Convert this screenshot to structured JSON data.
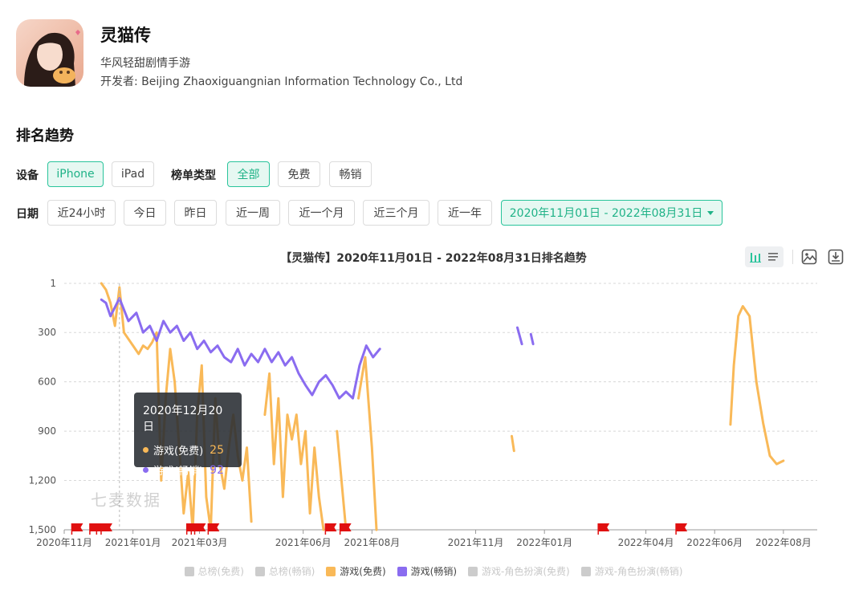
{
  "app": {
    "name": "灵猫传",
    "subtitle": "华风轻甜剧情手游",
    "developer": "开发者: Beijing Zhaoxiguangnian Information Technology Co., Ltd"
  },
  "section_title": "排名趋势",
  "filters": {
    "device_label": "设备",
    "devices": [
      {
        "label": "iPhone",
        "active": true
      },
      {
        "label": "iPad",
        "active": false
      }
    ],
    "list_type_label": "榜单类型",
    "list_types": [
      {
        "label": "全部",
        "active": true
      },
      {
        "label": "免费",
        "active": false
      },
      {
        "label": "畅销",
        "active": false
      }
    ],
    "date_label": "日期",
    "dates": [
      {
        "label": "近24小时"
      },
      {
        "label": "今日"
      },
      {
        "label": "昨日"
      },
      {
        "label": "近一周"
      },
      {
        "label": "近一个月"
      },
      {
        "label": "近三个月"
      },
      {
        "label": "近一年"
      }
    ],
    "date_range": "2020年11月01日 - 2022年08月31日"
  },
  "chart_title": "【灵猫传】2020年11月01日 - 2022年08月31日排名趋势",
  "toolbar_icons": [
    "bar-chart-icon",
    "list-icon",
    "image-icon",
    "download-icon"
  ],
  "tooltip": {
    "date": "2020年12月20日",
    "rows": [
      {
        "name": "游戏(免费)",
        "value": "25",
        "color": "#f9b958"
      },
      {
        "name": "游戏(畅销)",
        "value": "92",
        "color": "#8a6cf0"
      }
    ]
  },
  "watermark": "七麦数据",
  "colors": {
    "accent": "#1fb287",
    "free": "#f9b958",
    "grossing": "#8a6cf0",
    "flag": "#e01010",
    "legend_off": "#cccccc"
  },
  "legend": [
    {
      "label": "总榜(免费)",
      "on": false
    },
    {
      "label": "总榜(畅销)",
      "on": false
    },
    {
      "label": "游戏(免费)",
      "on": true
    },
    {
      "label": "游戏(畅销)",
      "on": true
    },
    {
      "label": "游戏-角色扮演(免费)",
      "on": false
    },
    {
      "label": "游戏-角色扮演(畅销)",
      "on": false
    }
  ],
  "chart_data": {
    "type": "line",
    "title": "【灵猫传】2020年11月01日 - 2022年08月31日排名趋势",
    "y_inverted": true,
    "ylim": [
      1,
      1500
    ],
    "y_ticks": [
      "1",
      "300",
      "600",
      "900",
      "1,200",
      "1,500"
    ],
    "x_ticks": [
      "2020年11月",
      "2021年01月",
      "2021年03月",
      "2021年06月",
      "2021年08月",
      "2021年11月",
      "2022年01月",
      "2022年04月",
      "2022年06月",
      "2022年08月"
    ],
    "grid": true,
    "legend_position": "bottom",
    "series": [
      {
        "name": "游戏(免费)",
        "color": "#f9b958",
        "segments": [
          [
            [
              "2020-12-04",
              1
            ],
            [
              "2020-12-08",
              40
            ],
            [
              "2020-12-12",
              120
            ],
            [
              "2020-12-16",
              260
            ],
            [
              "2020-12-20",
              25
            ],
            [
              "2020-12-24",
              300
            ],
            [
              "2021-01-01",
              380
            ],
            [
              "2021-01-06",
              430
            ],
            [
              "2021-01-10",
              380
            ],
            [
              "2021-01-14",
              400
            ],
            [
              "2021-01-18",
              360
            ],
            [
              "2021-01-22",
              300
            ],
            [
              "2021-01-26",
              1200
            ],
            [
              "2021-01-30",
              700
            ],
            [
              "2021-02-03",
              400
            ],
            [
              "2021-02-07",
              600
            ],
            [
              "2021-02-11",
              1000
            ],
            [
              "2021-02-15",
              1400
            ],
            [
              "2021-02-19",
              1150
            ],
            [
              "2021-02-23",
              1500
            ],
            [
              "2021-02-27",
              800
            ],
            [
              "2021-03-03",
              500
            ],
            [
              "2021-03-07",
              1300
            ],
            [
              "2021-03-11",
              1500
            ],
            [
              "2021-03-15",
              700
            ],
            [
              "2021-03-19",
              1100
            ],
            [
              "2021-03-23",
              1250
            ],
            [
              "2021-03-27",
              1000
            ],
            [
              "2021-03-31",
              800
            ],
            [
              "2021-04-04",
              1050
            ],
            [
              "2021-04-08",
              1200
            ],
            [
              "2021-04-12",
              1000
            ],
            [
              "2021-04-16",
              1450
            ]
          ],
          [
            [
              "2021-04-28",
              800
            ],
            [
              "2021-05-02",
              550
            ],
            [
              "2021-05-06",
              1100
            ],
            [
              "2021-05-10",
              700
            ],
            [
              "2021-05-14",
              1300
            ],
            [
              "2021-05-18",
              800
            ],
            [
              "2021-05-22",
              950
            ],
            [
              "2021-05-26",
              800
            ],
            [
              "2021-05-30",
              1100
            ],
            [
              "2021-06-03",
              900
            ],
            [
              "2021-06-07",
              1400
            ],
            [
              "2021-06-11",
              1000
            ],
            [
              "2021-06-15",
              1300
            ],
            [
              "2021-06-19",
              1500
            ]
          ],
          [
            [
              "2021-07-01",
              900
            ],
            [
              "2021-07-05",
              1200
            ],
            [
              "2021-07-09",
              1500
            ]
          ],
          [
            [
              "2021-07-20",
              700
            ],
            [
              "2021-07-26",
              450
            ],
            [
              "2021-08-01",
              1000
            ],
            [
              "2021-08-05",
              1500
            ]
          ],
          [
            [
              "2021-12-03",
              930
            ],
            [
              "2021-12-05",
              1020
            ]
          ],
          [
            [
              "2022-06-15",
              860
            ],
            [
              "2022-06-18",
              500
            ],
            [
              "2022-06-22",
              200
            ],
            [
              "2022-06-26",
              140
            ],
            [
              "2022-07-02",
              200
            ],
            [
              "2022-07-08",
              600
            ],
            [
              "2022-07-14",
              850
            ],
            [
              "2022-07-20",
              1050
            ],
            [
              "2022-07-26",
              1100
            ],
            [
              "2022-08-01",
              1080
            ]
          ]
        ]
      },
      {
        "name": "游戏(畅销)",
        "color": "#8a6cf0",
        "segments": [
          [
            [
              "2020-12-04",
              100
            ],
            [
              "2020-12-08",
              120
            ],
            [
              "2020-12-12",
              200
            ],
            [
              "2020-12-20",
              92
            ],
            [
              "2020-12-28",
              230
            ],
            [
              "2021-01-04",
              180
            ],
            [
              "2021-01-10",
              300
            ],
            [
              "2021-01-16",
              260
            ],
            [
              "2021-01-22",
              350
            ],
            [
              "2021-01-28",
              230
            ],
            [
              "2021-02-03",
              300
            ],
            [
              "2021-02-09",
              260
            ],
            [
              "2021-02-15",
              350
            ],
            [
              "2021-02-21",
              300
            ],
            [
              "2021-02-27",
              400
            ],
            [
              "2021-03-05",
              350
            ],
            [
              "2021-03-11",
              420
            ],
            [
              "2021-03-17",
              380
            ],
            [
              "2021-03-23",
              450
            ],
            [
              "2021-03-29",
              480
            ],
            [
              "2021-04-04",
              400
            ],
            [
              "2021-04-10",
              500
            ],
            [
              "2021-04-16",
              430
            ],
            [
              "2021-04-22",
              480
            ],
            [
              "2021-04-28",
              400
            ],
            [
              "2021-05-04",
              480
            ],
            [
              "2021-05-10",
              420
            ],
            [
              "2021-05-16",
              500
            ],
            [
              "2021-05-22",
              450
            ],
            [
              "2021-05-28",
              550
            ],
            [
              "2021-06-03",
              620
            ],
            [
              "2021-06-09",
              680
            ],
            [
              "2021-06-15",
              600
            ],
            [
              "2021-06-21",
              560
            ],
            [
              "2021-06-27",
              620
            ],
            [
              "2021-07-03",
              700
            ],
            [
              "2021-07-09",
              660
            ],
            [
              "2021-07-15",
              700
            ],
            [
              "2021-07-21",
              500
            ],
            [
              "2021-07-27",
              380
            ],
            [
              "2021-08-02",
              450
            ],
            [
              "2021-08-08",
              400
            ]
          ],
          [
            [
              "2021-12-08",
              270
            ],
            [
              "2021-12-12",
              370
            ]
          ],
          [
            [
              "2021-12-20",
              310
            ],
            [
              "2021-12-22",
              370
            ]
          ]
        ]
      }
    ],
    "markers": [
      "2020-11-12",
      "2020-11-28",
      "2020-12-04",
      "2020-12-08",
      "2021-02-22",
      "2021-02-26",
      "2021-03-01",
      "2021-03-13",
      "2021-06-25",
      "2021-07-08",
      "2022-02-22",
      "2022-05-02"
    ]
  }
}
